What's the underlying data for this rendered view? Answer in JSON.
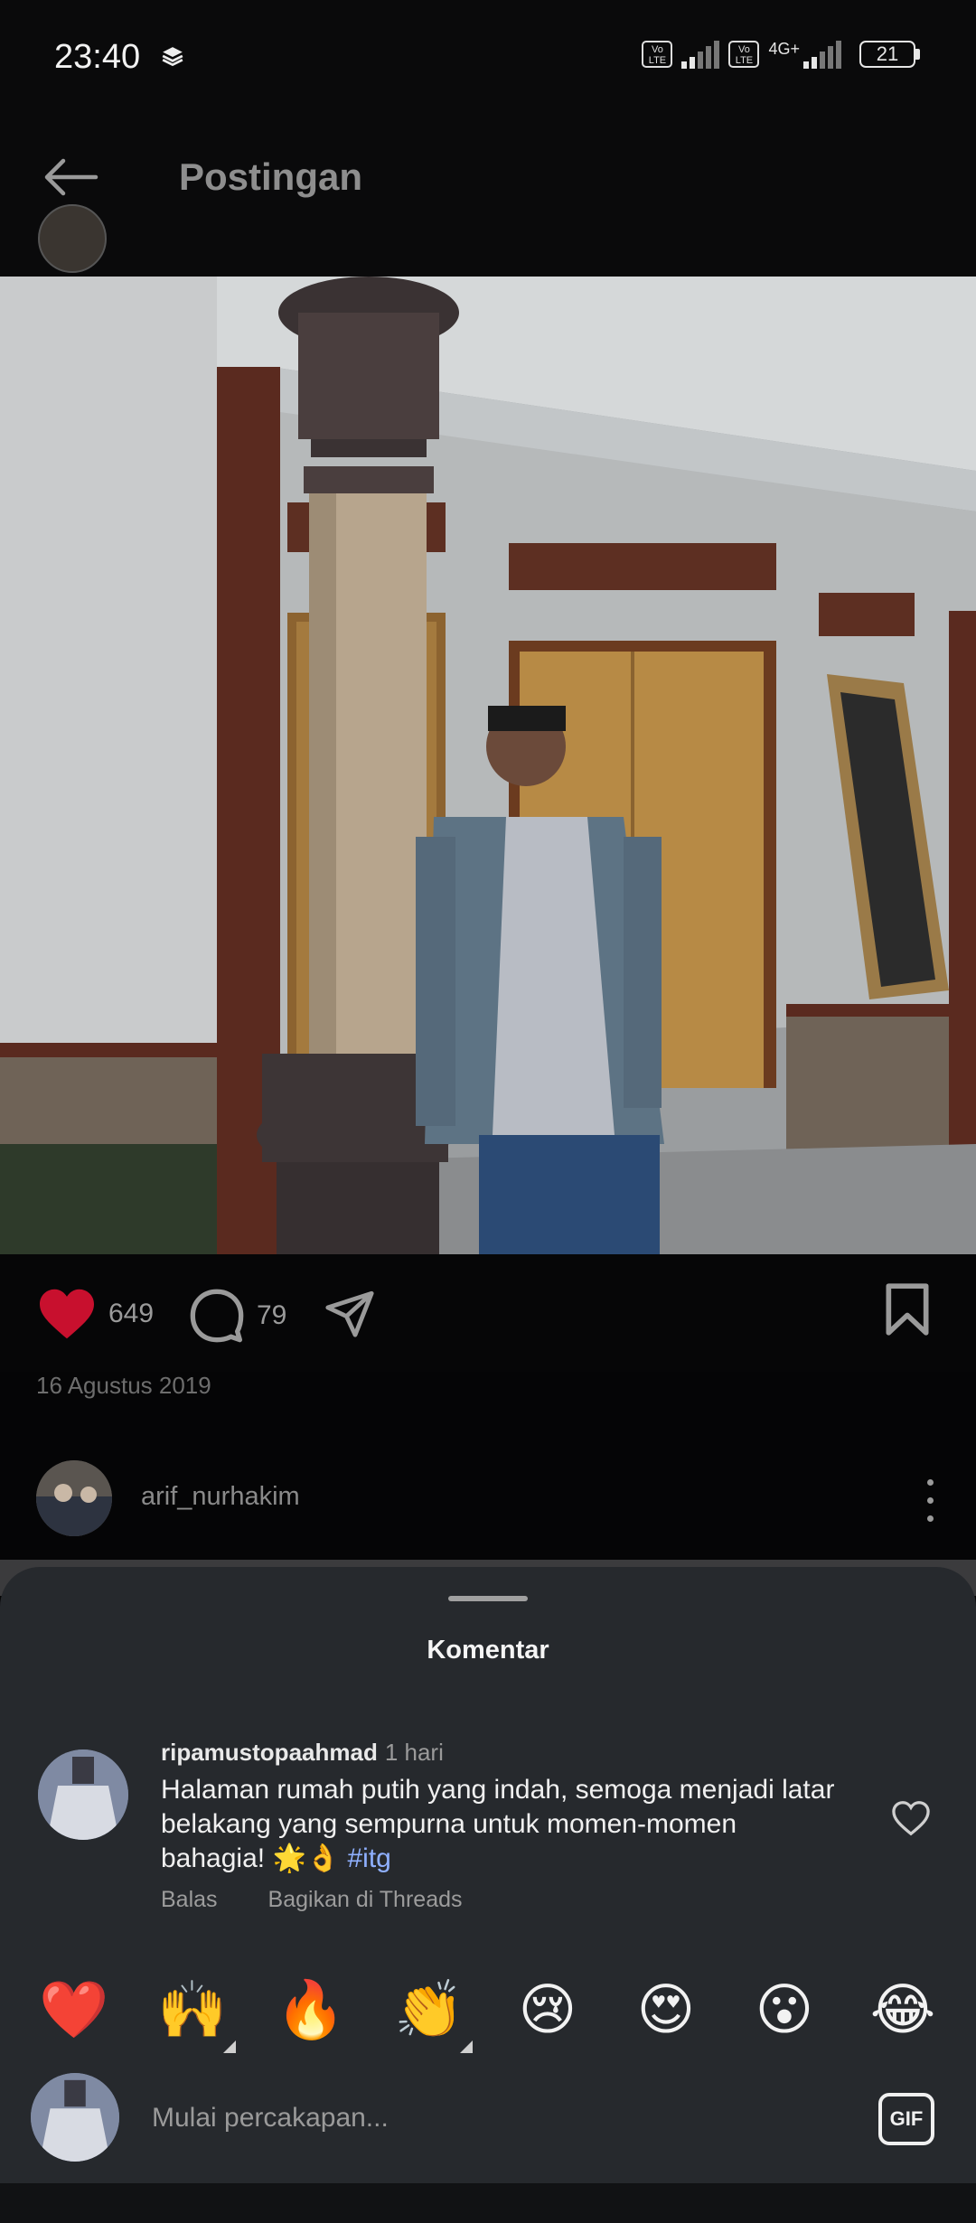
{
  "status_bar": {
    "time": "23:40",
    "volte_1": "Vo LTE",
    "volte_2": "Vo LTE",
    "network": "4G+",
    "battery": "21"
  },
  "header": {
    "title": "Postingan"
  },
  "post": {
    "like_count": "649",
    "comment_count": "79",
    "date": "16 Agustus 2019"
  },
  "next_post": {
    "username": "arif_nurhakim"
  },
  "comments_sheet": {
    "title": "Komentar",
    "comments": [
      {
        "username": "ripamustopaahmad",
        "time": "1 hari",
        "text": "Halaman rumah putih yang indah, semoga menjadi latar belakang yang sempurna untuk momen-momen bahagia! 🌟👌",
        "hashtag": "#itg",
        "reply_label": "Balas",
        "share_label": "Bagikan di Threads"
      }
    ],
    "quick_emojis": [
      "❤️",
      "🙌",
      "🔥",
      "👏",
      "😢",
      "😍",
      "😮",
      "😂"
    ],
    "input_placeholder": "Mulai percakapan...",
    "gif_label": "GIF"
  },
  "colors": {
    "like_red": "#c8102e",
    "sheet_bg": "#26292d",
    "hashtag": "#8fb0ff"
  }
}
